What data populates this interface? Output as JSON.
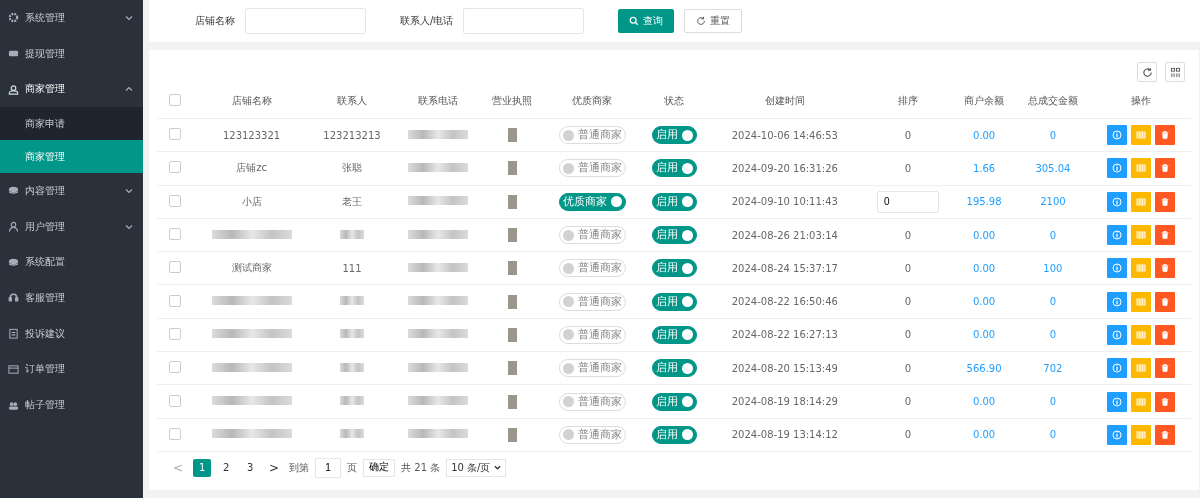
{
  "sidebar": {
    "items": [
      {
        "label": "系统管理",
        "expanded": false
      },
      {
        "label": "提现管理"
      },
      {
        "label": "商家管理",
        "expanded": true,
        "children": [
          {
            "label": "商家申请",
            "selected": false
          },
          {
            "label": "商家管理",
            "selected": true
          }
        ]
      },
      {
        "label": "内容管理",
        "expanded": false
      },
      {
        "label": "用户管理",
        "expanded": false
      },
      {
        "label": "系统配置"
      },
      {
        "label": "客服管理"
      },
      {
        "label": "投诉建议"
      },
      {
        "label": "订单管理"
      },
      {
        "label": "帖子管理"
      }
    ]
  },
  "search": {
    "fields": [
      {
        "label": "店铺名称"
      },
      {
        "label": "联系人/电话"
      }
    ],
    "query_button": "查询",
    "reset_button": "重置"
  },
  "table": {
    "all_checked": false,
    "columns": [
      "店铺名称",
      "联系人",
      "联系电话",
      "营业执照",
      "优质商家",
      "状态",
      "创建时间",
      "排序",
      "商户余额",
      "总成交金额",
      "操作"
    ],
    "rows": [
      {
        "checked": false,
        "shop": "123123321",
        "contact": "123213213",
        "premium": {
          "label": "普通商家",
          "on": false
        },
        "status": {
          "label": "启用",
          "on": true
        },
        "created": "2024-10-06 14:46:53",
        "sort": "0",
        "sort_editing": false,
        "balance": "0.00",
        "total": "0"
      },
      {
        "checked": false,
        "shop": "店铺zc",
        "contact": "张聪",
        "premium": {
          "label": "普通商家",
          "on": false
        },
        "status": {
          "label": "启用",
          "on": true
        },
        "created": "2024-09-20 16:31:26",
        "sort": "0",
        "sort_editing": false,
        "balance": "1.66",
        "total": "305.04"
      },
      {
        "checked": false,
        "shop": "小店",
        "contact": "老王",
        "premium": {
          "label": "优质商家",
          "on": true
        },
        "status": {
          "label": "启用",
          "on": true
        },
        "created": "2024-09-10 10:11:43",
        "sort": "0",
        "sort_editing": true,
        "balance": "195.98",
        "total": "2100"
      },
      {
        "checked": false,
        "premium": {
          "label": "普通商家",
          "on": false
        },
        "status": {
          "label": "启用",
          "on": true
        },
        "created": "2024-08-26 21:03:14",
        "sort": "0",
        "sort_editing": false,
        "balance": "0.00",
        "total": "0"
      },
      {
        "checked": false,
        "shop": "测试商家",
        "contact": "111",
        "premium": {
          "label": "普通商家",
          "on": false
        },
        "status": {
          "label": "启用",
          "on": true
        },
        "created": "2024-08-24 15:37:17",
        "sort": "0",
        "sort_editing": false,
        "balance": "0.00",
        "total": "100"
      },
      {
        "checked": false,
        "premium": {
          "label": "普通商家",
          "on": false
        },
        "status": {
          "label": "启用",
          "on": true
        },
        "created": "2024-08-22 16:50:46",
        "sort": "0",
        "sort_editing": false,
        "balance": "0.00",
        "total": "0"
      },
      {
        "checked": false,
        "premium": {
          "label": "普通商家",
          "on": false
        },
        "status": {
          "label": "启用",
          "on": true
        },
        "created": "2024-08-22 16:27:13",
        "sort": "0",
        "sort_editing": false,
        "balance": "0.00",
        "total": "0"
      },
      {
        "checked": false,
        "premium": {
          "label": "普通商家",
          "on": false
        },
        "status": {
          "label": "启用",
          "on": true
        },
        "created": "2024-08-20 15:13:49",
        "sort": "0",
        "sort_editing": false,
        "balance": "566.90",
        "total": "702"
      },
      {
        "checked": false,
        "premium": {
          "label": "普通商家",
          "on": false
        },
        "status": {
          "label": "启用",
          "on": true
        },
        "created": "2024-08-19 18:14:29",
        "sort": "0",
        "sort_editing": false,
        "balance": "0.00",
        "total": "0"
      },
      {
        "checked": false,
        "premium": {
          "label": "普通商家",
          "on": false
        },
        "status": {
          "label": "启用",
          "on": true
        },
        "created": "2024-08-19 13:14:12",
        "sort": "0",
        "sort_editing": false,
        "balance": "0.00",
        "total": "0"
      }
    ]
  },
  "pagination": {
    "prev": "<",
    "pages": [
      {
        "label": "1",
        "selected": true
      },
      {
        "label": "2",
        "selected": false
      },
      {
        "label": "3",
        "selected": false
      }
    ],
    "next": ">",
    "goto_label": "到第",
    "goto_value": "1",
    "page_unit": "页",
    "confirm": "确定",
    "total": "共 21 条",
    "page_size": "10 条/页"
  }
}
